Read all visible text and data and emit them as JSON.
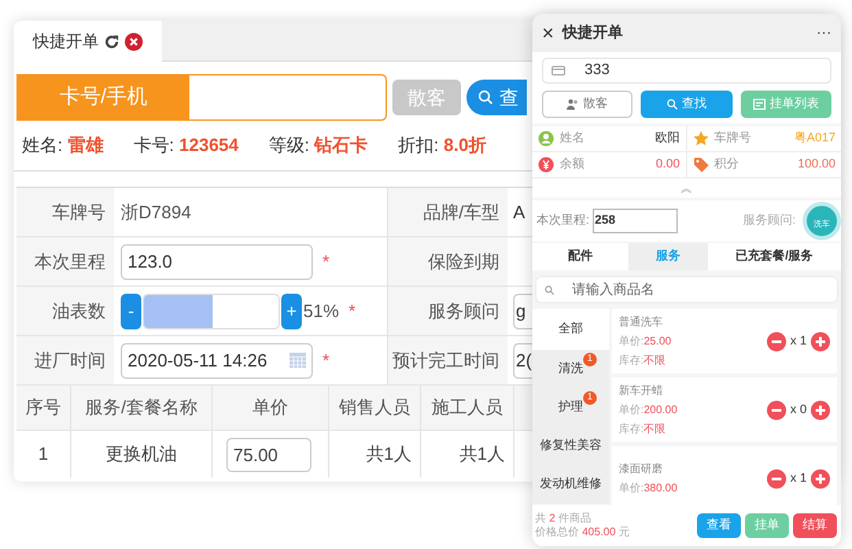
{
  "tab": {
    "label": "快捷开单"
  },
  "search": {
    "label": "卡号/手机",
    "buttons": [
      {
        "kind": "plain",
        "label": "散客"
      },
      {
        "kind": "search",
        "label": "查"
      }
    ]
  },
  "member": [
    {
      "label": "姓名:",
      "value": "雷雄"
    },
    {
      "label": "卡号:",
      "value": "123654"
    },
    {
      "label": "等级:",
      "value": "钻石卡"
    },
    {
      "label": "折扣:",
      "value": "8.0折"
    }
  ],
  "form_rows": [
    {
      "label": "车牌号",
      "kind": "text",
      "value": "浙D7894",
      "required": false,
      "label_2": "品牌/车型",
      "value_2": "A",
      "field_2": false
    },
    {
      "label": "本次里程",
      "kind": "input",
      "value": "123.0",
      "required": true,
      "label_2": "保险到期"
    },
    {
      "label": "油表数",
      "kind": "gauge",
      "minus": "-",
      "plus": "+",
      "level": 0.51,
      "reading": "51%",
      "required": true,
      "label_2": "服务顾问",
      "value_2": "g",
      "field_2": true
    },
    {
      "label": "进厂时间",
      "kind": "date",
      "value": "2020-05-11 14:26",
      "required": true,
      "label_2": "预计完工时间",
      "value_2": "2(",
      "field_2": true
    }
  ],
  "required_mark": "*",
  "services": {
    "columns": [
      "序号",
      "服务/套餐名称",
      "单价",
      "销售人员",
      "施工人员"
    ],
    "rows": [
      {
        "index": "1",
        "name": "更换机油",
        "price": "75.00",
        "sales": "共1人",
        "workers": "共1人"
      }
    ]
  },
  "panel": {
    "close": "×",
    "title": "快捷开单",
    "more": "···",
    "card_number": "333",
    "buttons": [
      {
        "kind": "walkin",
        "label": "散客"
      },
      {
        "kind": "search",
        "label": "查找"
      },
      {
        "kind": "list",
        "label": "挂单列表"
      }
    ],
    "info": [
      {
        "kind": "person",
        "label": "姓名",
        "value": "欧阳",
        "color": "#333333"
      },
      {
        "kind": "star",
        "label": "车牌号",
        "value": "粤A017",
        "color": "#f5a623"
      },
      {
        "kind": "yen",
        "label": "余额",
        "value": "0.00",
        "color": "#f0505a"
      },
      {
        "kind": "tag",
        "label": "积分",
        "value": "100.00",
        "color": "#f06a50"
      }
    ],
    "chevron": "︽",
    "mileage_label": "本次里程:",
    "mileage": "258",
    "advisor_label": "服务顾问:",
    "fab_label": "洗车",
    "tabs": [
      {
        "label": "配件",
        "selected": false
      },
      {
        "label": "服务",
        "selected": true
      },
      {
        "label": "已充套餐/服务",
        "selected": false
      }
    ],
    "product_search": {
      "placeholder": "请输入商品名"
    },
    "categories": [
      {
        "label": "全部",
        "selected": true
      },
      {
        "label": "清洗",
        "badge": "1",
        "selected": false
      },
      {
        "label": "护理",
        "badge": "1",
        "selected": false
      },
      {
        "label": "修复性美容",
        "selected": false
      },
      {
        "label": "发动机维修",
        "selected": false
      }
    ],
    "products": [
      {
        "name": "普通洗车",
        "price_label": "单价:",
        "price": "25.00",
        "stock_label": "库存:",
        "stock": "不限",
        "qty": "x 1"
      },
      {
        "name": "新车开蜡",
        "price_label": "单价:",
        "price": "200.00",
        "stock_label": "库存:",
        "stock": "不限",
        "qty": "x 0"
      },
      {
        "name": "漆面研磨",
        "price_label": "单价:",
        "price": "380.00",
        "qty": "x 1"
      }
    ],
    "summary": {
      "count_prefix": "共",
      "count": "2",
      "count_suffix": "件商品",
      "total_label": "价格总价",
      "total": "405.00",
      "total_suffix": "元"
    },
    "footer_buttons": [
      {
        "kind": "view",
        "label": "查看"
      },
      {
        "kind": "hold",
        "label": "挂单"
      },
      {
        "kind": "checkout",
        "label": "结算"
      }
    ]
  }
}
